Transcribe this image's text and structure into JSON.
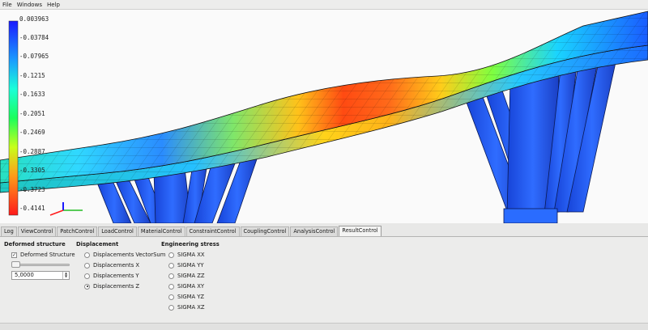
{
  "menubar": {
    "items": [
      "File",
      "Windows",
      "Help"
    ]
  },
  "legend": {
    "values": [
      "0.003963",
      "-0.03784",
      "-0.07965",
      "-0.1215",
      "-0.1633",
      "-0.2051",
      "-0.2469",
      "-0.2887",
      "-0.3305",
      "-0.3723",
      "-0.4141"
    ],
    "colors": [
      "#1a1aff",
      "#1a5cff",
      "#1a9bff",
      "#1ad4ff",
      "#1affd9",
      "#1aff5c",
      "#6dff1a",
      "#c8ff1a",
      "#ffd21a",
      "#ff7a1a",
      "#ff1a1a"
    ]
  },
  "tabs": [
    {
      "label": "Log",
      "active": false
    },
    {
      "label": "ViewControl",
      "active": false
    },
    {
      "label": "PatchControl",
      "active": false
    },
    {
      "label": "LoadControl",
      "active": false
    },
    {
      "label": "MaterialControl",
      "active": false
    },
    {
      "label": "ConstraintControl",
      "active": false
    },
    {
      "label": "CouplingControl",
      "active": false
    },
    {
      "label": "AnalysisControl",
      "active": false
    },
    {
      "label": "ResultControl",
      "active": true
    }
  ],
  "result_control": {
    "deformed": {
      "title": "Deformed structure",
      "checkbox_label": "Deformed Structure",
      "checked": true,
      "scale_value": "5,0000"
    },
    "displacement": {
      "title": "Displacement",
      "options": [
        "Displacements VectorSum",
        "Displacements X",
        "Displacements Y",
        "Displacements Z"
      ],
      "selected": "Displacements Z"
    },
    "stress": {
      "title": "Engineering stress",
      "options": [
        "SIGMA XX",
        "SIGMA YY",
        "SIGMA ZZ",
        "SIGMA XY",
        "SIGMA YZ",
        "SIGMA XZ"
      ],
      "selected": ""
    }
  }
}
